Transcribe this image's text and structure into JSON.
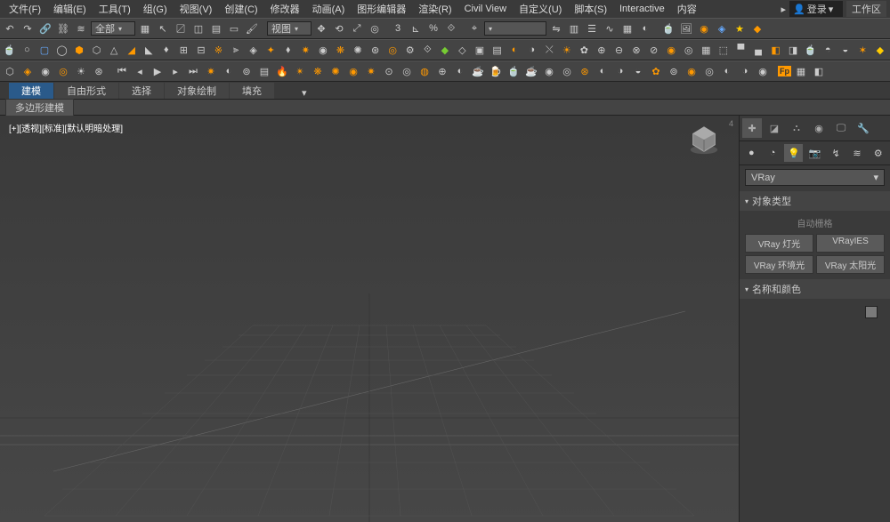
{
  "menu": {
    "items": [
      "文件(F)",
      "编辑(E)",
      "工具(T)",
      "组(G)",
      "视图(V)",
      "创建(C)",
      "修改器",
      "动画(A)",
      "图形编辑器",
      "渲染(R)",
      "Civil View",
      "自定义(U)",
      "脚本(S)",
      "Interactive",
      "内容"
    ],
    "login_label": "登录",
    "workspace_label": "工作区"
  },
  "toolbar1": {
    "all_label": "全部",
    "view_label": "视图"
  },
  "tabs": {
    "items": [
      "建模",
      "自由形式",
      "选择",
      "对象绘制",
      "填充"
    ],
    "active": 0,
    "ribbon_sub": "多边形建模"
  },
  "viewport": {
    "label": "[+][透视][标准][默认明暗处理]"
  },
  "panel": {
    "renderer_dropdown": "VRay",
    "section1_title": "对象类型",
    "auto_label": "自动栅格",
    "buttons": [
      "VRay 灯光",
      "VRayIES",
      "VRay 环境光",
      "VRay 太阳光"
    ],
    "section2_title": "名称和颜色"
  }
}
